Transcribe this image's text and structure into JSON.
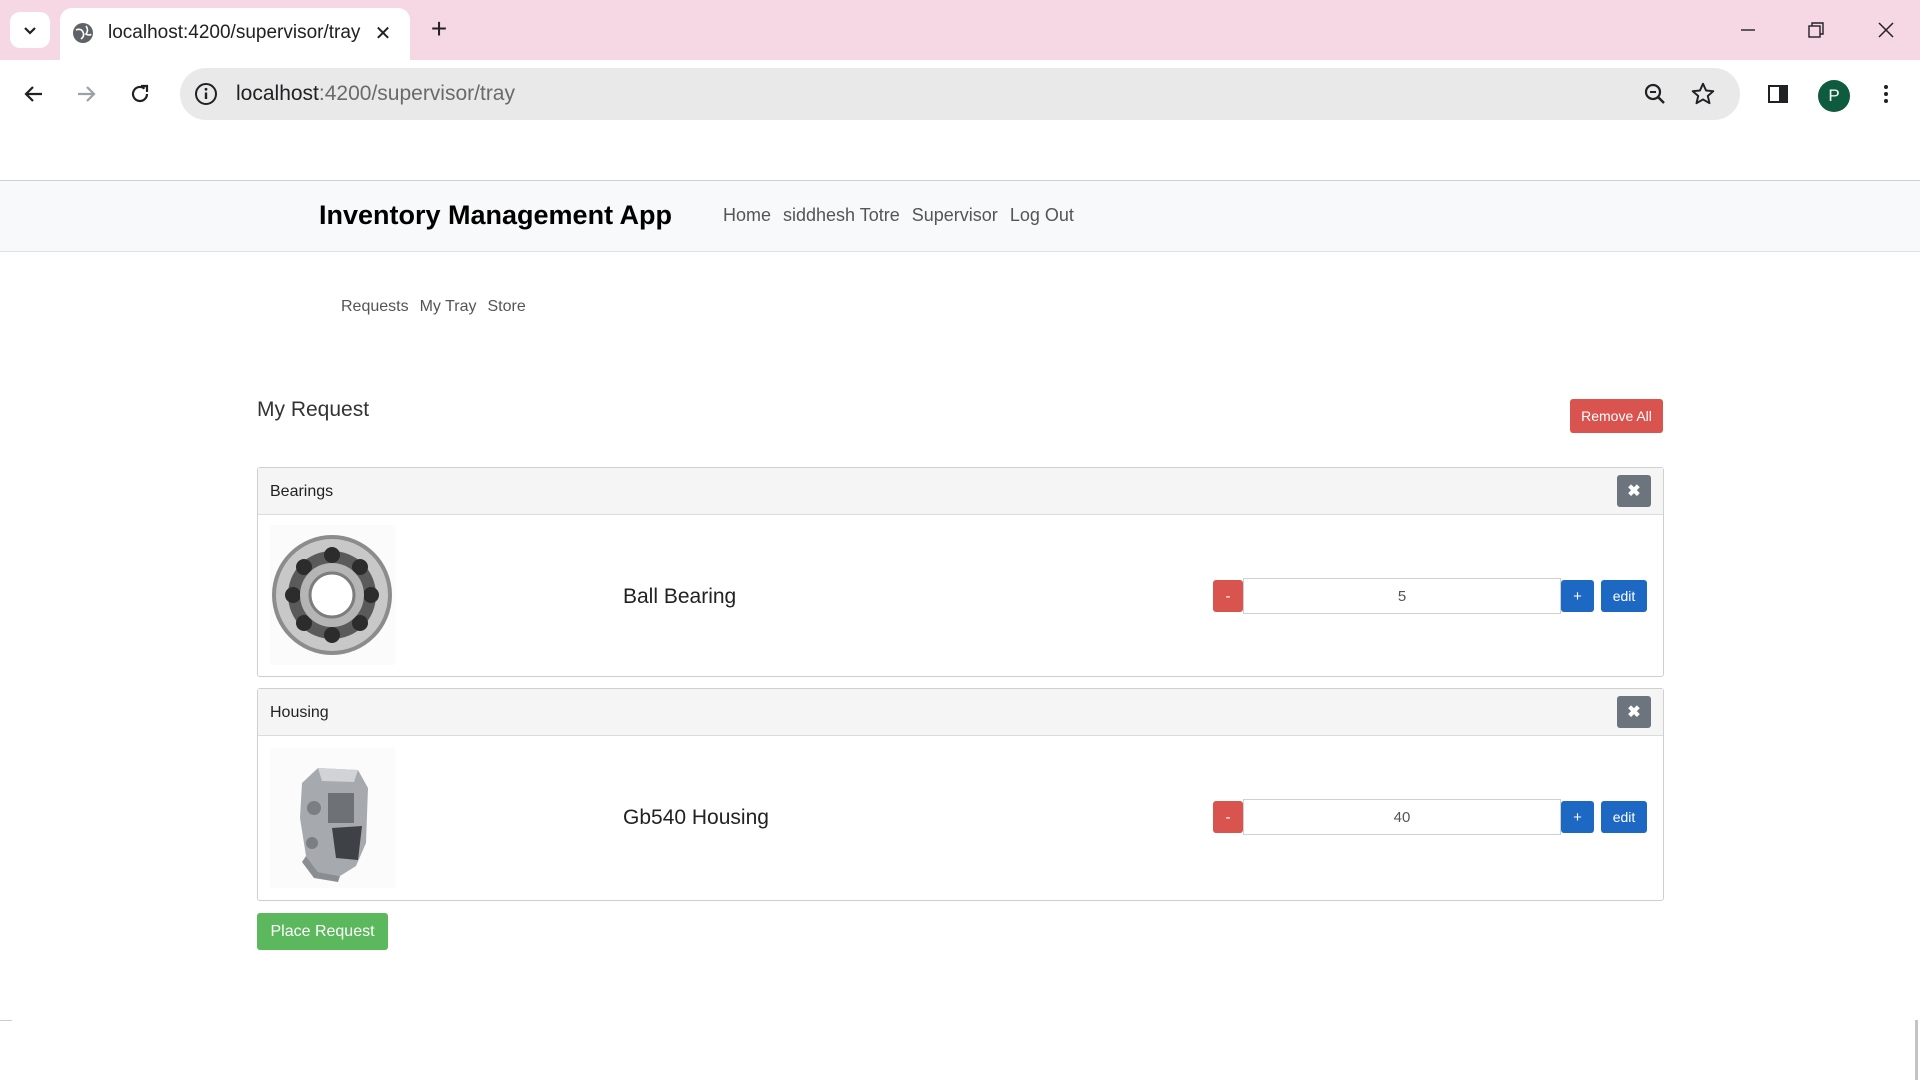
{
  "browser": {
    "tab_title": "localhost:4200/supervisor/tray",
    "url_host": "localhost",
    "url_path": ":4200/supervisor/tray",
    "profile_initial": "P",
    "colors": {
      "tabbar": "#f6d7e4",
      "omnibox": "#e9e9ea",
      "avatar": "#0f5b3d"
    }
  },
  "app": {
    "brand": "Inventory Management App",
    "nav": [
      "Home",
      "siddhesh Totre",
      "Supervisor",
      "Log Out"
    ],
    "subnav": [
      "Requests",
      "My Tray",
      "Store"
    ]
  },
  "tray": {
    "title": "My Request",
    "remove_all_label": "Remove All",
    "place_request_label": "Place Request",
    "items": [
      {
        "category": "Bearings",
        "name": "Ball Bearing",
        "quantity": "5",
        "minus": "-",
        "plus": "+",
        "edit": "edit",
        "close": "✖"
      },
      {
        "category": "Housing",
        "name": "Gb540 Housing",
        "quantity": "40",
        "minus": "-",
        "plus": "+",
        "edit": "edit",
        "close": "✖"
      }
    ],
    "colors": {
      "danger": "#d9534f",
      "primary": "#1c68c2",
      "success": "#5cb85c",
      "secondary": "#6c757d"
    }
  }
}
